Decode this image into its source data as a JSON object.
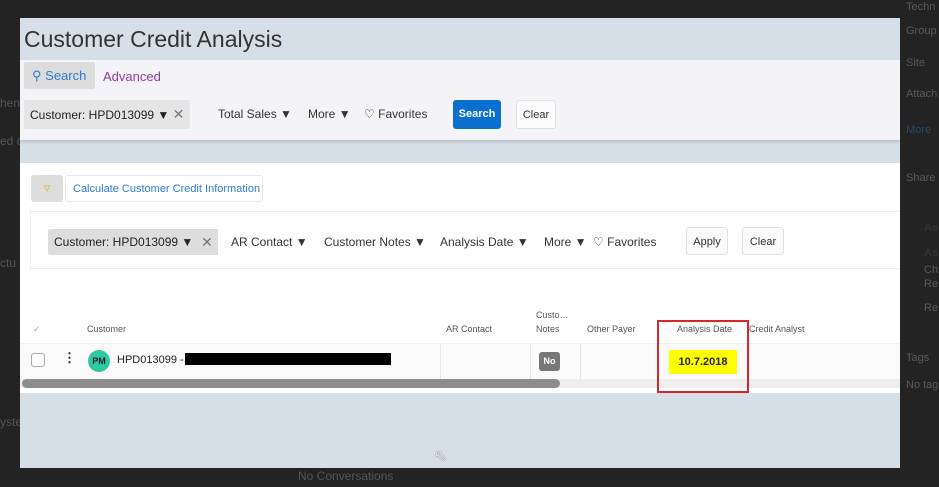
{
  "background": {
    "left_fragments": [
      "hen",
      "ed c",
      "ctu",
      "yste"
    ],
    "bottom_text": "No Conversations",
    "right_sidebar": [
      "Techn",
      "Group",
      "Site",
      "Attach",
      "More",
      "Share",
      "As",
      "As",
      "Ch",
      "Re",
      "Re",
      "Tags",
      "No tag"
    ]
  },
  "page": {
    "title": "Customer Credit Analysis"
  },
  "search": {
    "tab_search": "Search",
    "tab_advanced": "Advanced",
    "customer_filter": "Customer: HPD013099",
    "total_sales": "Total Sales",
    "more": "More",
    "favorites": "Favorites",
    "search_button": "Search",
    "clear_button": "Clear"
  },
  "actions": {
    "calculate_button": "Calculate Customer Credit Information"
  },
  "filters": {
    "customer_filter": "Customer: HPD013099",
    "ar_contact": "AR Contact",
    "customer_notes": "Customer Notes",
    "analysis_date": "Analysis Date",
    "more": "More",
    "favorites": "Favorites",
    "apply_button": "Apply",
    "clear_button": "Clear"
  },
  "table": {
    "columns": {
      "customer": "Customer",
      "ar_contact": "AR Contact",
      "notes_top": "Custo…",
      "notes": "Notes",
      "other_payer": "Other Payer",
      "analysis_date": "Analysis Date",
      "credit_analyst": "Credit Analyst"
    },
    "rows": [
      {
        "avatar": "PM",
        "customer": "HPD013099 -",
        "notes_badge": "No",
        "analysis_date": "10.7.2018"
      }
    ]
  },
  "colors": {
    "highlight": "#ffff00",
    "annotation": "#d9262b",
    "primary": "#0a6fcf",
    "avatar": "#2ec9a0"
  }
}
